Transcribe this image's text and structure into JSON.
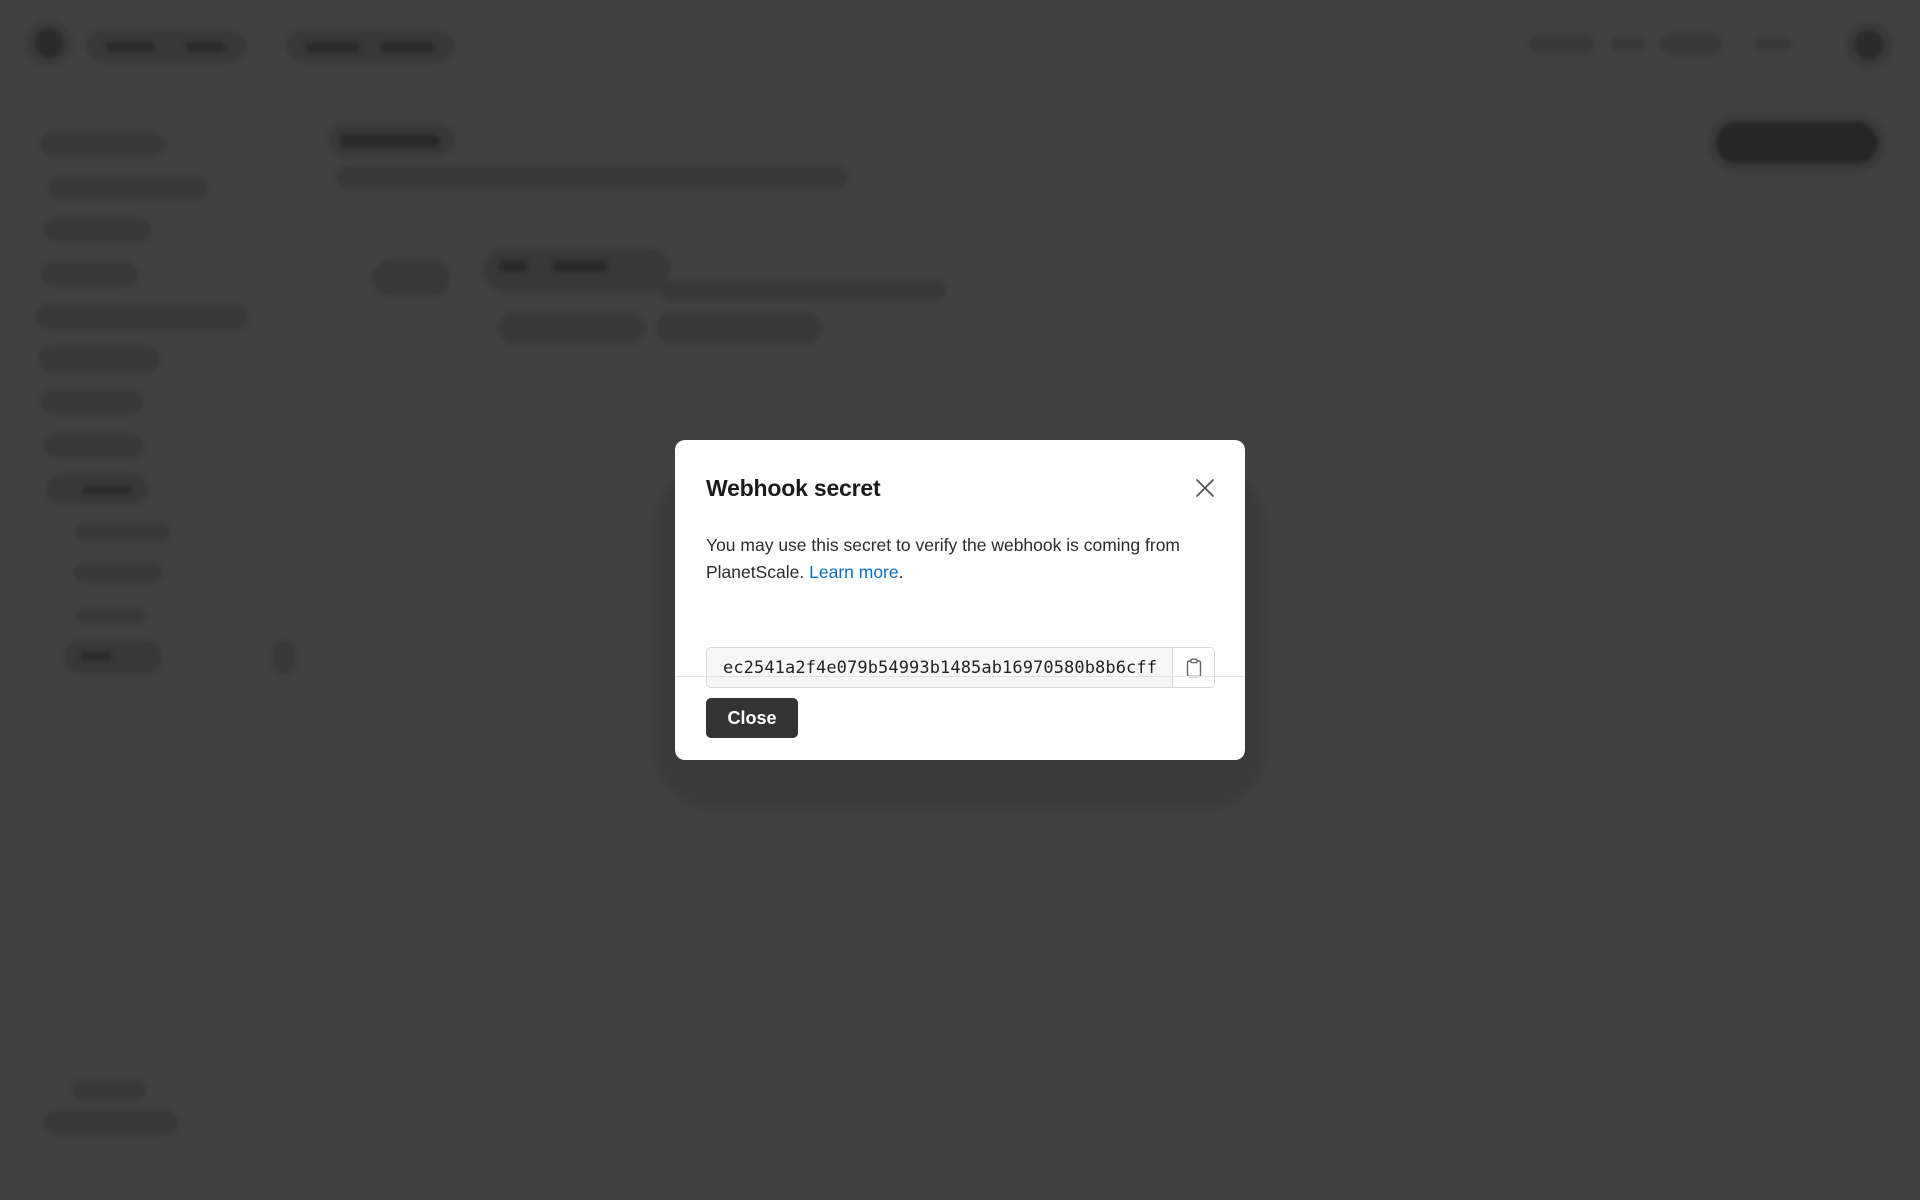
{
  "modal": {
    "title": "Webhook secret",
    "description_prefix": "You may use this secret to verify the webhook is coming from PlanetScale. ",
    "learn_more_label": "Learn more",
    "description_suffix": ".",
    "secret_value": "ec2541a2f4e079b54993b1485ab16970580b8b6cff",
    "close_button_label": "Close",
    "icons": {
      "close": "close-icon",
      "copy": "clipboard-icon"
    }
  },
  "colors": {
    "overlay_background": "#414141",
    "link": "#0b6fc1",
    "primary_button": "#333333"
  }
}
